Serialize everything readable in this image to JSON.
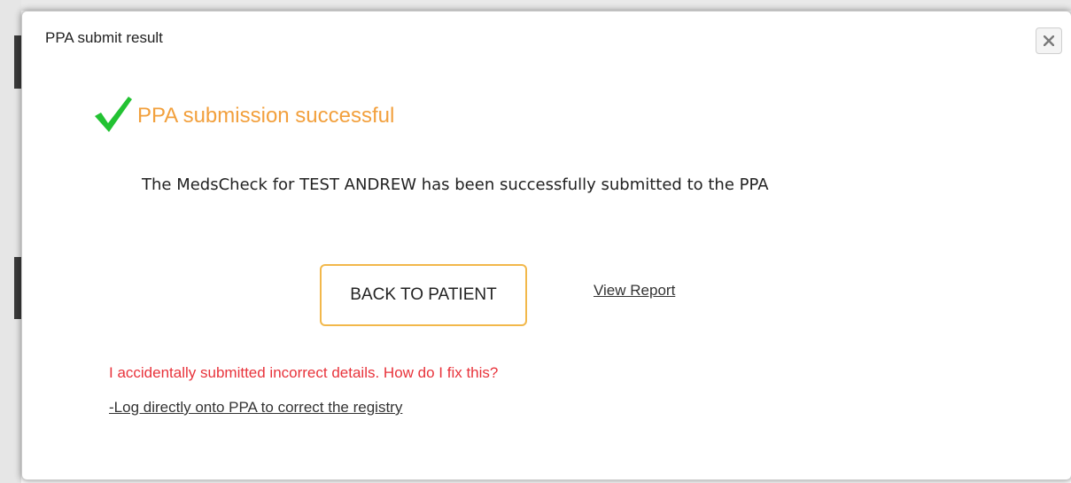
{
  "dialog": {
    "title": "PPA submit result",
    "close_icon": "close-icon",
    "success": {
      "icon": "checkmark-icon",
      "icon_color": "#22c232",
      "text": "PPA submission successful",
      "text_color": "#f2a03d"
    },
    "message": "The MedsCheck for TEST ANDREW has been successfully submitted to the PPA",
    "actions": {
      "back_label": "BACK TO PATIENT",
      "back_border_color": "#f2b84b",
      "view_report_label": "View Report"
    },
    "help": {
      "question": "I accidentally submitted incorrect details. How do I fix this?",
      "question_color": "#e8333b",
      "link_label": "-Log directly onto PPA to correct the registry"
    }
  }
}
